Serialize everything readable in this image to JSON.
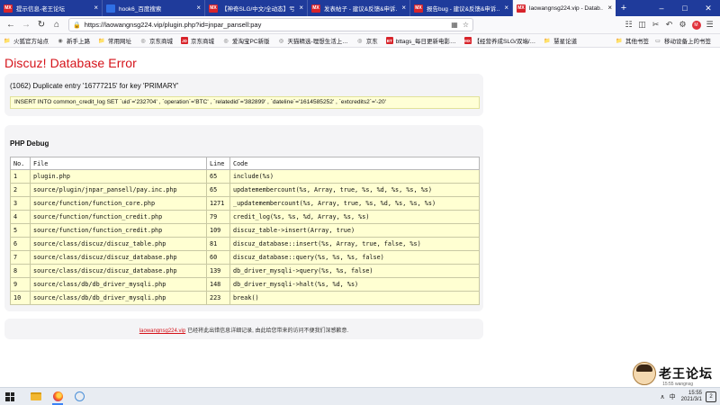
{
  "browser": {
    "tabs": [
      {
        "favicon": "red",
        "favicon_text": "MX",
        "title": "提示信息-老王论坛",
        "active": false
      },
      {
        "favicon": "blue",
        "favicon_text": "",
        "title": "hook6_百度搜索",
        "active": false
      },
      {
        "favicon": "red",
        "favicon_text": "MX",
        "title": "【神奇SLG/中文/全动态】亏…",
        "active": false
      },
      {
        "favicon": "red",
        "favicon_text": "MX",
        "title": "发表帖子 - 建议&反馈&申诉…",
        "active": false
      },
      {
        "favicon": "red",
        "favicon_text": "MX",
        "title": "报告bug - 建议&反馈&申诉…",
        "active": false
      },
      {
        "favicon": "red",
        "favicon_text": "MX",
        "title": "laowangnsg224.vip - Datab…",
        "active": true
      }
    ],
    "new_tab_label": "+",
    "url": "https://laowangnsg224.vip/plugin.php?id=jnpar_pansell:pay",
    "bookmarks": [
      {
        "icon": "folder",
        "label": "火狐官方站点"
      },
      {
        "icon": "firefox",
        "label": "新手上路"
      },
      {
        "icon": "folder",
        "label": "常用网址"
      },
      {
        "icon": "globe",
        "label": "京东商城"
      },
      {
        "icon": "jd",
        "label": "京东商城"
      },
      {
        "icon": "globe",
        "label": "爱淘宝PC新版"
      },
      {
        "icon": "globe",
        "label": "天猫精选-理想生活上…"
      },
      {
        "icon": "globe",
        "label": "京东"
      },
      {
        "icon": "bt",
        "label": "bttags_每日更新电影…"
      },
      {
        "icon": "mx",
        "label": "【经营养成SLG/双端/…"
      },
      {
        "icon": "folder",
        "label": "慧星论道"
      }
    ],
    "bookmarks_right": [
      {
        "icon": "folder",
        "label": "其他书签"
      },
      {
        "icon": "device",
        "label": "移动设备上的书签"
      }
    ]
  },
  "page": {
    "title": "Discuz! Database Error",
    "error_message": "(1062) Duplicate entry '16777215' for key 'PRIMARY'",
    "sql": "INSERT INTO common_credit_log SET `uid`='232704' , `operation`='BTC' , `relatedid`='382899' , `dateline`='1614585252' , `extcredits2`='-20'",
    "debug_heading": "PHP Debug",
    "table": {
      "headers": [
        "No.",
        "File",
        "Line",
        "Code"
      ],
      "rows": [
        [
          "1",
          "plugin.php",
          "65",
          "include(%s)"
        ],
        [
          "2",
          "source/plugin/jnpar_pansell/pay.inc.php",
          "65",
          "updatemembercount(%s, Array, true, %s, %d, %s, %s, %s)"
        ],
        [
          "3",
          "source/function/function_core.php",
          "1271",
          "_updatemembercount(%s, Array, true, %s, %d, %s, %s, %s)"
        ],
        [
          "4",
          "source/function/function_credit.php",
          "79",
          "credit_log(%s, %s, %d, Array, %s, %s)"
        ],
        [
          "5",
          "source/function/function_credit.php",
          "109",
          "discuz_table->insert(Array, true)"
        ],
        [
          "6",
          "source/class/discuz/discuz_table.php",
          "81",
          "discuz_database::insert(%s, Array, true, false, %s)"
        ],
        [
          "7",
          "source/class/discuz/discuz_database.php",
          "60",
          "discuz_database::query(%s, %s, %s, false)"
        ],
        [
          "8",
          "source/class/discuz/discuz_database.php",
          "139",
          "db_driver_mysqli->query(%s, %s, false)"
        ],
        [
          "9",
          "source/class/db/db_driver_mysqli.php",
          "148",
          "db_driver_mysqli->halt(%s, %d, %s)"
        ],
        [
          "10",
          "source/class/db/db_driver_mysqli.php",
          "223",
          "break()"
        ]
      ]
    },
    "footer_link": "laowangnsg224.vip",
    "footer_text": "已经将此出错信息详细记录, 由此给您带来的访问不便我们深感歉意."
  },
  "watermark": {
    "text": "老王论坛",
    "sub": "15:55 wangnsg"
  },
  "taskbar": {
    "ime": "中",
    "time": "15:55",
    "date": "2021/3/1",
    "notification_count": "2"
  }
}
